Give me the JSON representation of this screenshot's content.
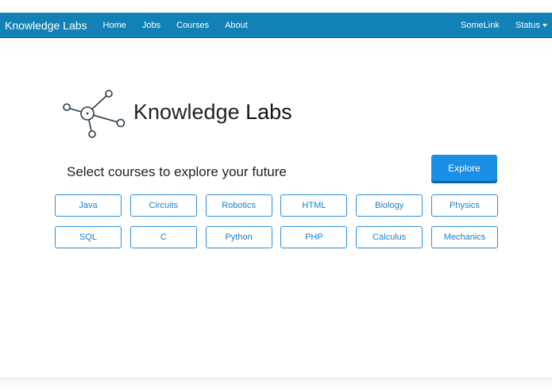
{
  "navbar": {
    "brand": "Knowledge Labs",
    "links": [
      "Home",
      "Jobs",
      "Courses",
      "About"
    ],
    "right_links": [
      "SomeLink",
      "Status"
    ]
  },
  "logo": {
    "text_light": "Knowledge ",
    "text_bold": "Labs"
  },
  "headline": "Select courses to explore your future",
  "explore_label": "Explore",
  "courses": {
    "row1": [
      "Java",
      "Circuits",
      "Robotics",
      "HTML",
      "Biology",
      "Physics"
    ],
    "row2": [
      "SQL",
      "C",
      "Python",
      "PHP",
      "Calculus",
      "Mechanics"
    ]
  },
  "colors": {
    "navbar": "#1281b5",
    "accent": "#1a8fe3",
    "course_border": "#2c8fd9"
  },
  "icons": [
    "network-logo-icon",
    "dropdown-caret-icon"
  ]
}
